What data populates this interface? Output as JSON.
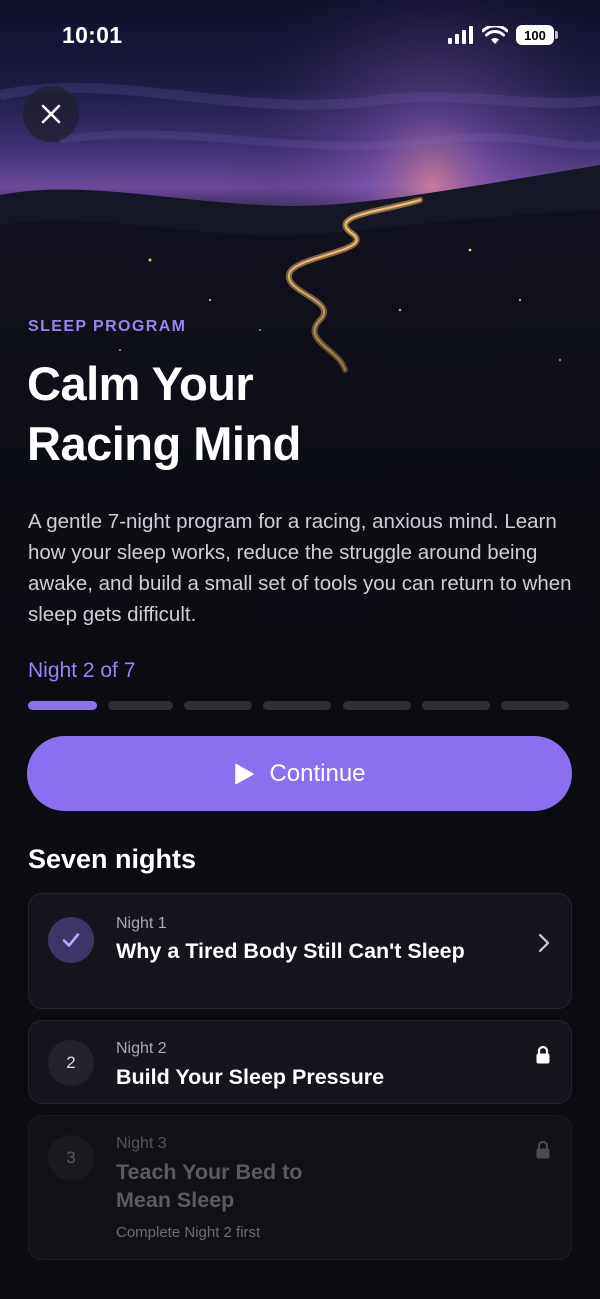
{
  "status_bar": {
    "time": "10:01",
    "battery": "100"
  },
  "program": {
    "eyebrow": "SLEEP PROGRAM",
    "title_line1": "Calm Your",
    "title_line2": "Racing Mind",
    "description": "A gentle 7-night program for a racing, anxious mind. Learn how your sleep works, reduce the struggle around being awake, and build a small set of tools you can return to when sleep gets difficult."
  },
  "progress": {
    "label": "Night 2 of 7",
    "current": 2,
    "total": 7
  },
  "continue_button": {
    "label": "Continue",
    "icon": "play-icon"
  },
  "nights_section": {
    "title": "Seven nights",
    "items": [
      {
        "night": "Night 1",
        "title": "Why a Tired Body Still Can't Sleep",
        "status": "completed",
        "icon": "check-icon",
        "action_icon": "chevron-right-icon"
      },
      {
        "night": "Night 2",
        "number": "2",
        "title": "Build Your Sleep Pressure",
        "status": "locked",
        "icon": "lock-icon"
      },
      {
        "night": "Night 3",
        "number": "3",
        "title": "Teach Your Bed to Mean Sleep",
        "status": "locked",
        "hint": "Complete Night 2 first",
        "icon": "lock-icon"
      }
    ]
  },
  "colors": {
    "accent": "#8a6ff0",
    "background": "#0b0c12",
    "card": "#15161d"
  }
}
